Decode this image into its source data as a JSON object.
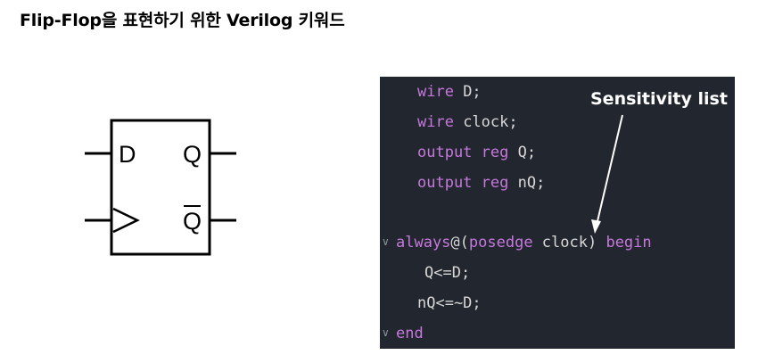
{
  "title": "Flip-Flop을 표현하기 위한 Verilog 키워드",
  "diagram": {
    "input_d": "D",
    "output_q": "Q",
    "output_q_bar": "Q"
  },
  "code": {
    "line1": {
      "kw": "wire",
      "rest": " D;"
    },
    "line2": {
      "kw": "wire",
      "rest": " clock;"
    },
    "line3": {
      "kw1": "output",
      "kw2": "reg",
      "rest": " Q;"
    },
    "line4": {
      "kw1": "output",
      "kw2": "reg",
      "rest": " nQ;"
    },
    "line5": {
      "kw1": "always",
      "mid": "@(",
      "kw2": "posedge",
      "rest": " clock) ",
      "kw3": "begin"
    },
    "line6": {
      "text": "Q<=D;"
    },
    "line7": {
      "text": "nQ<=~D;"
    },
    "line8": {
      "kw": "end"
    }
  },
  "annotation": {
    "label": "Sensitivity list"
  },
  "colors": {
    "code_background": "#22262e",
    "keyword": "#c678dd",
    "code_text": "#d7d7d7",
    "annotation_text": "#ffffff"
  }
}
